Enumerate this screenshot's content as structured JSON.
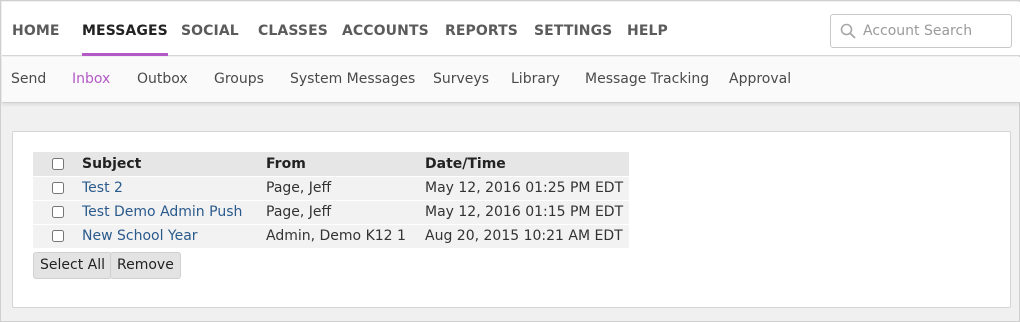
{
  "topnav": {
    "items": [
      {
        "label": "HOME"
      },
      {
        "label": "MESSAGES",
        "active": true
      },
      {
        "label": "SOCIAL"
      },
      {
        "label": "CLASSES"
      },
      {
        "label": "ACCOUNTS"
      },
      {
        "label": "REPORTS"
      },
      {
        "label": "SETTINGS"
      },
      {
        "label": "HELP"
      }
    ],
    "search_placeholder": "Account Search",
    "accent_color": "#b45ac6"
  },
  "subnav": {
    "items": [
      {
        "label": "Send"
      },
      {
        "label": "Inbox",
        "active": true
      },
      {
        "label": "Outbox"
      },
      {
        "label": "Groups"
      },
      {
        "label": "System Messages"
      },
      {
        "label": "Surveys"
      },
      {
        "label": "Library"
      },
      {
        "label": "Message Tracking"
      },
      {
        "label": "Approval"
      }
    ]
  },
  "table": {
    "headers": {
      "subject": "Subject",
      "from": "From",
      "datetime": "Date/Time"
    },
    "rows": [
      {
        "subject": "Test 2",
        "from": "Page, Jeff",
        "datetime": "May 12, 2016 01:25 PM EDT"
      },
      {
        "subject": "Test Demo Admin Push",
        "from": "Page, Jeff",
        "datetime": "May 12, 2016 01:15 PM EDT"
      },
      {
        "subject": "New School Year",
        "from": "Admin, Demo K12 1",
        "datetime": "Aug 20, 2015 10:21 AM EDT"
      }
    ],
    "link_color": "#2a5a8c"
  },
  "actions": {
    "select_all": "Select All",
    "remove": "Remove"
  }
}
